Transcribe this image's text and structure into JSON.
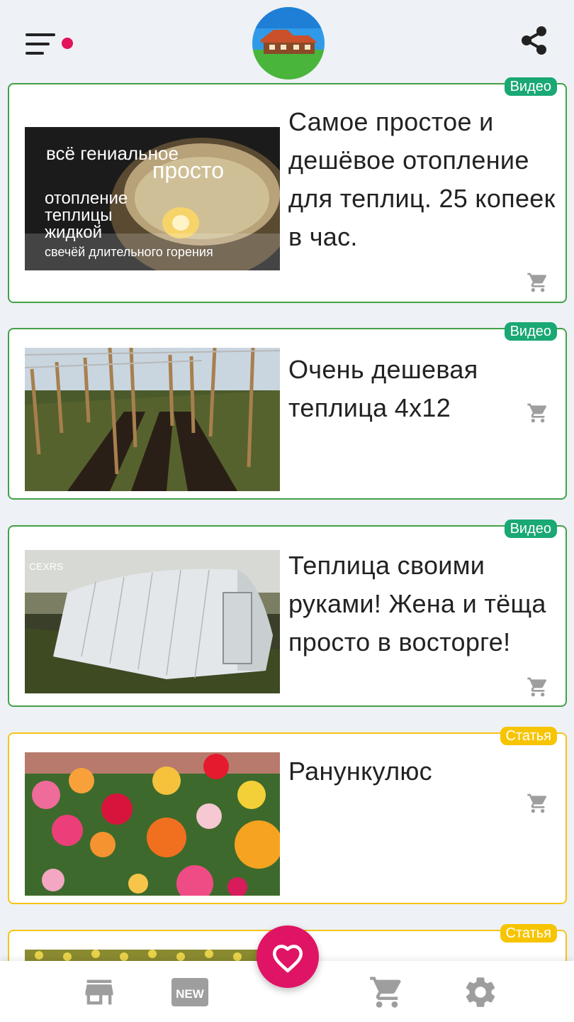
{
  "header": {
    "menu_icon": "hamburger-menu-icon",
    "notification_color": "#e2145a",
    "logo": "house-logo-avatar",
    "share_icon": "share-icon"
  },
  "feed": [
    {
      "type_label": "Видео",
      "title": "Самое простое и дешёвое отопление для теплиц. 25 копеек в час.",
      "thumb_caption_1": "всё гениальное",
      "thumb_caption_2": "просто",
      "thumb_caption_3": "отопление",
      "thumb_caption_4": "теплицы",
      "thumb_caption_5": "жидкой",
      "thumb_caption_6": "свечёй длительного горения"
    },
    {
      "type_label": "Видео",
      "title": "Очень дешевая теплица 4х12"
    },
    {
      "type_label": "Видео",
      "title": "Теплица своими руками! Жена и тёща просто в восторге!",
      "thumb_watermark": "CEXRS"
    },
    {
      "type_label": "Статья",
      "title": "Ранункулюс"
    },
    {
      "type_label": "Статья",
      "title": ""
    }
  ],
  "bottom_nav": {
    "items": [
      "store-icon",
      "new-icon",
      "heart-icon",
      "cart-icon",
      "settings-icon"
    ],
    "new_label": "NEW",
    "accent": "#e01464"
  },
  "colors": {
    "video_border": "#43a047",
    "video_badge": "#1aa874",
    "article_border": "#f5c518",
    "article_badge": "#f7c400"
  }
}
